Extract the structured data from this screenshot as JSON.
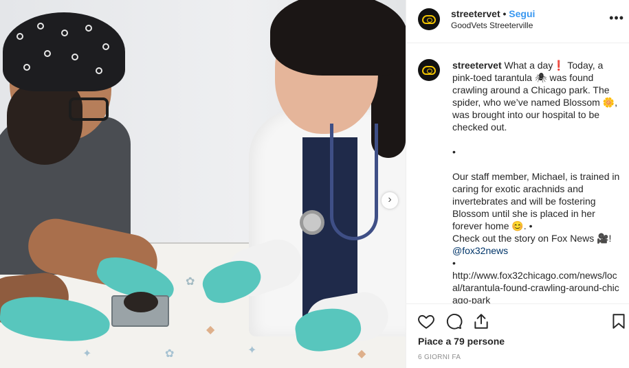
{
  "post": {
    "username": "streetervet",
    "dot": "•",
    "follow_label": "Segui",
    "location": "GoodVets Streeterville",
    "more_icon": "more-options-icon",
    "more_label": "•••"
  },
  "caption": {
    "username": "streetervet",
    "para1": "What a day❗️ Today, a pink-toed tarantula 🕷 was found crawling around a Chicago park.  The spider, who we’ve named Blossom 🌼, was brought into our hospital to be checked out.",
    "bullet1": "•",
    "para2": "Our staff member, Michael, is trained in caring for exotic arachnids and invertebrates and will be fostering Blossom until she is placed in her forever home 😊. •",
    "para3": "Check out the story on Fox News 🎥!",
    "mention": "@fox32news",
    "bullet2": "•",
    "link": "http://www.fox32chicago.com/news/local/tarantula-found-crawling-around-chicago-park"
  },
  "actions": {
    "like_icon": "heart-icon",
    "comment_icon": "comment-icon",
    "share_icon": "share-icon",
    "save_icon": "bookmark-icon",
    "likes_text": "Piace a 79 persone",
    "time_text": "6 giorni fa"
  },
  "photo": {
    "next_icon": "chevron-right-icon",
    "next_label": "›"
  }
}
